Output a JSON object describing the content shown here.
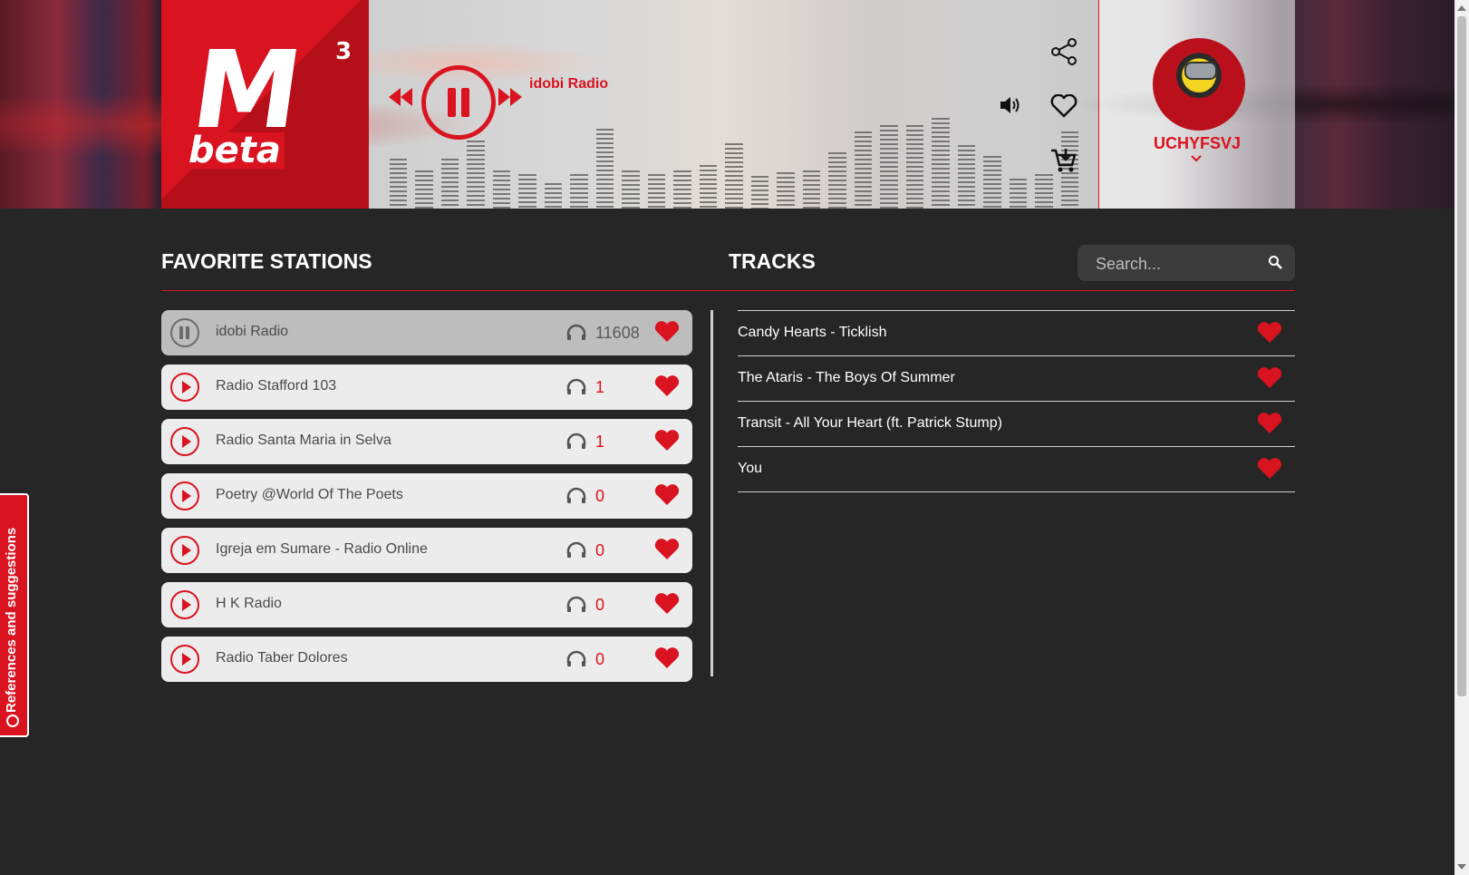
{
  "brand": {
    "logo_text": "M",
    "logo_sup": "3",
    "logo_beta": "beta"
  },
  "player": {
    "now_playing": "idobi Radio"
  },
  "user": {
    "name": "UCHYFSVJ"
  },
  "side_tab": {
    "label": "References and suggestions"
  },
  "sections": {
    "favorites_title": "FAVORITE STATIONS",
    "tracks_title": "TRACKS"
  },
  "search": {
    "placeholder": "Search..."
  },
  "stations": [
    {
      "name": "idobi Radio",
      "listeners": "11608",
      "active": true
    },
    {
      "name": "Radio Stafford 103",
      "listeners": "1"
    },
    {
      "name": "Radio Santa Maria in Selva",
      "listeners": "1"
    },
    {
      "name": "Poetry @World Of The Poets",
      "listeners": "0"
    },
    {
      "name": "Igreja em Sumare - Radio Online",
      "listeners": "0"
    },
    {
      "name": "H K Radio",
      "listeners": "0"
    },
    {
      "name": "Radio Taber Dolores",
      "listeners": "0"
    }
  ],
  "tracks": [
    {
      "title": "Candy Hearts - Ticklish"
    },
    {
      "title": "The Ataris - The Boys Of Summer"
    },
    {
      "title": "Transit - All Your Heart (ft. Patrick Stump)"
    },
    {
      "title": "You"
    }
  ],
  "colors": {
    "accent": "#d9131f",
    "background": "#262626"
  }
}
